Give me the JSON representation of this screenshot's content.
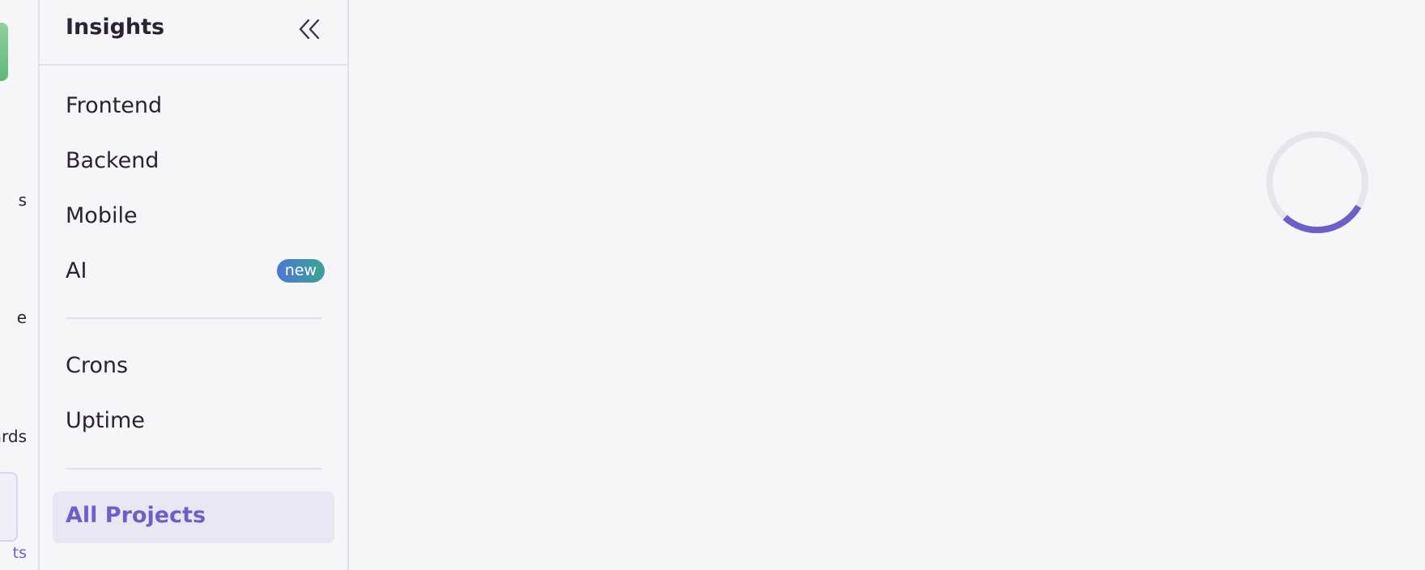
{
  "rail": {
    "labels": [
      "s",
      "e",
      "ards"
    ],
    "active_label": "ts"
  },
  "sidebar": {
    "title": "Insights",
    "items": [
      {
        "label": "Frontend"
      },
      {
        "label": "Backend"
      },
      {
        "label": "Mobile"
      },
      {
        "label": "AI",
        "badge": "new"
      },
      {
        "label": "Crons"
      },
      {
        "label": "Uptime"
      }
    ],
    "all_projects": "All Projects"
  },
  "icons": {
    "collapse": "chevrons-double-left-icon"
  },
  "colors": {
    "accent": "#6c5fc7",
    "spinner_track": "#e5e6ea",
    "badge_gradient_start": "#4a77d4",
    "badge_gradient_end": "#3ca493",
    "logo_green": "#6cc28a"
  }
}
